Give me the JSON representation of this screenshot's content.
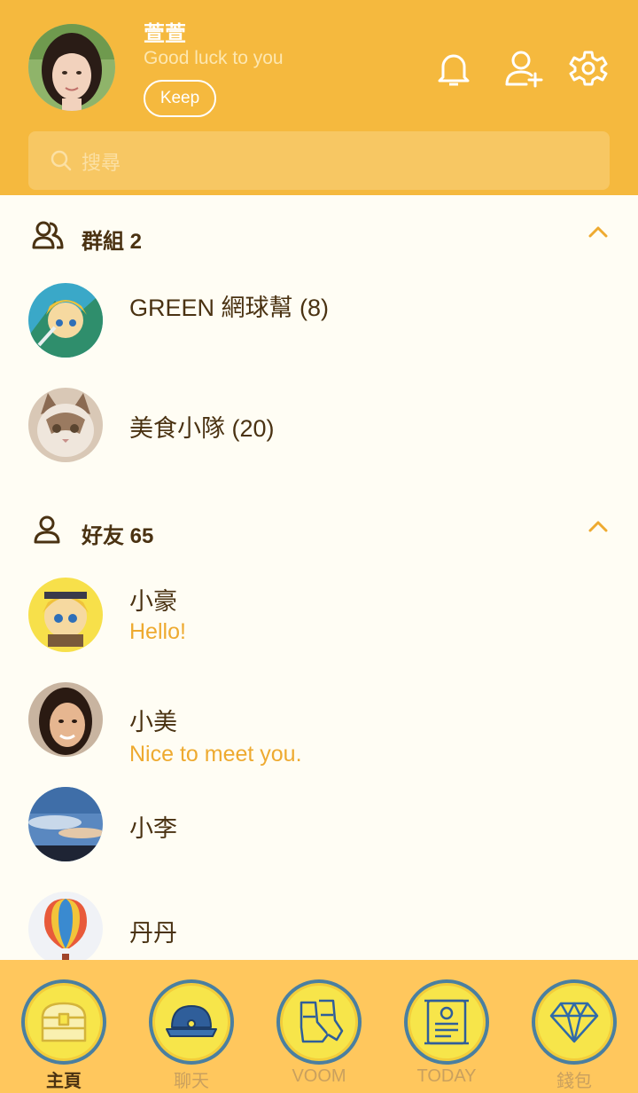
{
  "profile": {
    "name": "萱萱",
    "status": "Good luck to you",
    "keep_label": "Keep"
  },
  "search": {
    "placeholder": "搜尋"
  },
  "groups": {
    "title": "群組 2",
    "items": [
      {
        "name": "GREEN 網球幫 (8)"
      },
      {
        "name": "美食小隊 (20)"
      }
    ]
  },
  "friends": {
    "title": "好友 65",
    "items": [
      {
        "name": "小豪",
        "status": "Hello!"
      },
      {
        "name": "小美",
        "status": "Nice to meet you."
      },
      {
        "name": "小李"
      },
      {
        "name": "丹丹"
      }
    ]
  },
  "nav": {
    "items": [
      {
        "label": "主頁",
        "icon": "treasure-chest-icon",
        "active": true
      },
      {
        "label": "聊天",
        "icon": "helmet-icon"
      },
      {
        "label": "VOOM",
        "icon": "boots-icon"
      },
      {
        "label": "TODAY",
        "icon": "scroll-icon"
      },
      {
        "label": "錢包",
        "icon": "diamond-icon"
      }
    ]
  },
  "colors": {
    "header": "#f5b93e",
    "background": "#fffdf4",
    "text": "#4a3212",
    "accent": "#eeaa30",
    "nav_bg": "#ffc75d"
  }
}
